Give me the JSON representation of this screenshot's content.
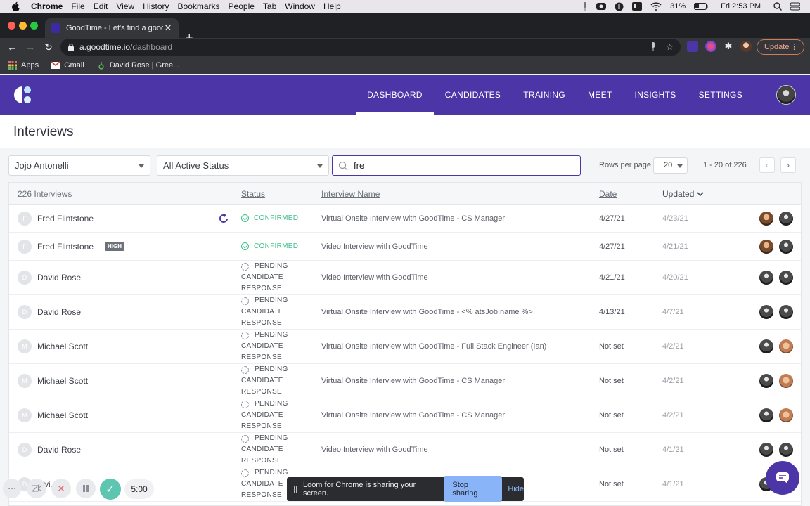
{
  "menubar": {
    "app": "Chrome",
    "items": [
      "File",
      "Edit",
      "View",
      "History",
      "Bookmarks",
      "People",
      "Tab",
      "Window",
      "Help"
    ],
    "battery": "31%",
    "clock": "Fri 2:53 PM"
  },
  "browser": {
    "tab_title": "GoodTime - Let's find a good t",
    "url_host": "a.goodtime.io",
    "url_path": "/dashboard",
    "update_label": "Update",
    "bookmarks": [
      "Apps",
      "Gmail",
      "David Rose | Gree..."
    ]
  },
  "nav": {
    "links": [
      "DASHBOARD",
      "CANDIDATES",
      "TRAINING",
      "MEET",
      "INSIGHTS",
      "SETTINGS"
    ],
    "active": "DASHBOARD"
  },
  "page": {
    "title": "Interviews"
  },
  "filters": {
    "user": "Jojo Antonelli",
    "status": "All Active Status",
    "search_value": "fre",
    "rows_per_page_label": "Rows per page",
    "rows_per_page": "20",
    "range": "1 - 20 of 226"
  },
  "table": {
    "count_label": "226 Interviews",
    "headers": {
      "status": "Status",
      "interview_name": "Interview Name",
      "date": "Date",
      "updated": "Updated"
    },
    "rows": [
      {
        "initial": "F",
        "name": "Fred Flintstone",
        "status": "CONFIRMED",
        "interview": "Virtual Onsite Interview with GoodTime - CS Manager",
        "date": "4/27/21",
        "updated": "4/23/21"
      },
      {
        "initial": "F",
        "name": "Fred Flintstone",
        "badge": "HIGH",
        "status": "CONFIRMED",
        "interview": "Video Interview with GoodTime",
        "date": "4/27/21",
        "updated": "4/21/21"
      },
      {
        "initial": "D",
        "name": "David Rose",
        "status_lines": [
          "PENDING",
          "CANDIDATE",
          "RESPONSE"
        ],
        "interview": "Video Interview with GoodTime",
        "date": "4/21/21",
        "updated": "4/20/21"
      },
      {
        "initial": "D",
        "name": "David Rose",
        "status_lines": [
          "PENDING",
          "CANDIDATE",
          "RESPONSE"
        ],
        "interview": "Virtual Onsite Interview with GoodTime - <% atsJob.name %>",
        "date": "4/13/21",
        "updated": "4/7/21"
      },
      {
        "initial": "M",
        "name": "Michael Scott",
        "status_lines": [
          "PENDING",
          "CANDIDATE",
          "RESPONSE"
        ],
        "interview": "Virtual Onsite Interview with GoodTime - Full Stack Engineer (Ian)",
        "date": "Not set",
        "updated": "4/2/21"
      },
      {
        "initial": "M",
        "name": "Michael Scott",
        "status_lines": [
          "PENDING",
          "CANDIDATE",
          "RESPONSE"
        ],
        "interview": "Virtual Onsite Interview with GoodTime - CS Manager",
        "date": "Not set",
        "updated": "4/2/21"
      },
      {
        "initial": "M",
        "name": "Michael Scott",
        "status_lines": [
          "PENDING",
          "CANDIDATE",
          "RESPONSE"
        ],
        "interview": "Virtual Onsite Interview with GoodTime - CS Manager",
        "date": "Not set",
        "updated": "4/2/21"
      },
      {
        "initial": "D",
        "name": "David Rose",
        "status_lines": [
          "PENDING",
          "CANDIDATE",
          "RESPONSE"
        ],
        "interview": "Video Interview with GoodTime",
        "date": "Not set",
        "updated": "4/1/21"
      },
      {
        "initial": "D",
        "name": "...vi...es",
        "status_lines": [
          "PENDING",
          "CANDIDATE",
          "RESPONSE"
        ],
        "interview": "",
        "date": "Not set",
        "updated": "4/1/21"
      }
    ]
  },
  "loom": {
    "timer": "5:00",
    "message": "Loom for Chrome is sharing your screen.",
    "stop_label": "Stop sharing",
    "hide_label": "Hide"
  }
}
